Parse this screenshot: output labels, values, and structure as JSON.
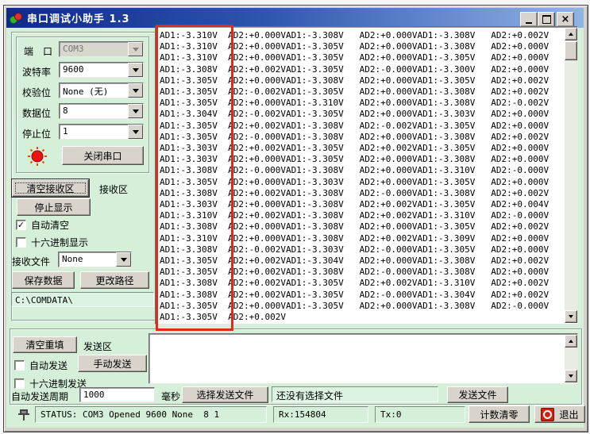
{
  "window": {
    "title": "串口调试小助手 1.3"
  },
  "left_panel": {
    "port_label": "端　口",
    "port_value": "COM3",
    "baud_label": "波特率",
    "baud_value": "9600",
    "parity_label": "校验位",
    "parity_value": "None (无)",
    "databits_label": "数据位",
    "databits_value": "8",
    "stopbits_label": "停止位",
    "stopbits_value": "1",
    "close_port_button": "关闭串口",
    "clear_rx_button": "清空接收区",
    "rx_area_label": "接收区",
    "stop_display_button": "停止显示",
    "auto_clear_label": "自动清空",
    "auto_clear_check": "✓",
    "hex_display_label": "十六进制显示",
    "hex_display_check": "",
    "rx_file_label": "接收文件",
    "rx_file_value": "None",
    "save_data_button": "保存数据",
    "change_path_button": "更改路径",
    "save_path": "C:\\COMDATA\\"
  },
  "receive": {
    "lines": [
      "AD1:-3.310V  AD2:+0.000VAD1:-3.308V   AD2:+0.000VAD1:-3.308V   AD2:+0.002V",
      "AD1:-3.310V  AD2:+0.000VAD1:-3.305V   AD2:+0.000VAD1:-3.308V   AD2:+0.000V",
      "AD1:-3.310V  AD2:+0.000VAD1:-3.305V   AD2:+0.000VAD1:-3.305V   AD2:+0.000V",
      "AD1:-3.308V  AD2:+0.002VAD1:-3.305V   AD2:-0.000VAD1:-3.300V   AD2:+0.000V",
      "AD1:-3.305V  AD2:+0.000VAD1:-3.308V   AD2:+0.000VAD1:-3.305V   AD2:+0.002V",
      "AD1:-3.305V  AD2:-0.002VAD1:-3.305V   AD2:+0.000VAD1:-3.308V   AD2:+0.002V",
      "AD1:-3.305V  AD2:+0.000VAD1:-3.310V   AD2:+0.000VAD1:-3.308V   AD2:-0.002V",
      "AD1:-3.304V  AD2:-0.002VAD1:-3.305V   AD2:+0.000VAD1:-3.303V   AD2:+0.000V",
      "AD1:-3.305V  AD2:+0.002VAD1:-3.308V   AD2:-0.002VAD1:-3.305V   AD2:+0.000V",
      "AD1:-3.305V  AD2:-0.000VAD1:-3.308V   AD2:+0.000VAD1:-3.308V   AD2:+0.002V",
      "AD1:-3.303V  AD2:+0.002VAD1:-3.305V   AD2:+0.002VAD1:-3.305V   AD2:+0.000V",
      "AD1:-3.303V  AD2:+0.000VAD1:-3.305V   AD2:+0.000VAD1:-3.308V   AD2:+0.000V",
      "AD1:-3.308V  AD2:-0.000VAD1:-3.308V   AD2:+0.000VAD1:-3.310V   AD2:-0.000V",
      "AD1:-3.305V  AD2:+0.000VAD1:-3.303V   AD2:+0.000VAD1:-3.305V   AD2:+0.000V",
      "AD1:-3.308V  AD2:+0.002VAD1:-3.308V   AD2:-0.000VAD1:-3.308V   AD2:+0.002V",
      "AD1:-3.303V  AD2:+0.000VAD1:-3.308V   AD2:+0.002VAD1:-3.305V   AD2:+0.004V",
      "AD1:-3.310V  AD2:+0.002VAD1:-3.308V   AD2:+0.002VAD1:-3.310V   AD2:-0.000V",
      "AD1:-3.308V  AD2:+0.000VAD1:-3.308V   AD2:+0.000VAD1:-3.305V   AD2:+0.002V",
      "AD1:-3.310V  AD2:+0.000VAD1:-3.308V   AD2:+0.002VAD1:-3.309V   AD2:+0.000V",
      "AD1:-3.308V  AD2:-0.002VAD1:-3.303V   AD2:-0.000VAD1:-3.305V   AD2:+0.000V",
      "AD1:-3.305V  AD2:+0.002VAD1:-3.304V   AD2:+0.000VAD1:-3.308V   AD2:+0.002V",
      "AD1:-3.305V  AD2:+0.002VAD1:-3.308V   AD2:-0.000VAD1:-3.308V   AD2:+0.000V",
      "AD1:-3.308V  AD2:+0.002VAD1:-3.305V   AD2:+0.002VAD1:-3.310V   AD2:+0.002V",
      "AD1:-3.308V  AD2:+0.002VAD1:-3.305V   AD2:-0.000VAD1:-3.304V   AD2:+0.002V",
      "AD1:-3.305V  AD2:+0.000VAD1:-3.305V   AD2:+0.000VAD1:-3.308V   AD2:-0.000V",
      "AD1:-3.305V  AD2:+0.002V"
    ]
  },
  "send": {
    "clear_button": "清空重填",
    "area_label": "发送区",
    "auto_send_label": "自动发送",
    "auto_send_check": "",
    "manual_send_button": "手动发送",
    "hex_send_label": "十六进制发送",
    "hex_send_check": "",
    "period_label": "自动发送周期",
    "period_value": "1000",
    "ms_label": "毫秒",
    "choose_file_button": "选择发送文件",
    "file_status": "还没有选择文件",
    "send_file_button": "发送文件",
    "text": ""
  },
  "statusbar": {
    "status": "STATUS: COM3 Opened 9600 None  8 1",
    "rx": "Rx:154804",
    "tx": "Tx:0",
    "reset_button": "计数清零",
    "exit_button": "退出"
  },
  "colors": {
    "client_bg": "#d5efd9",
    "title_start": "#0f2a8a",
    "title_end": "#8fb4e6",
    "highlight_red": "#e02a1a",
    "led_red": "#ee1111",
    "button_face": "#d8d4cc"
  }
}
